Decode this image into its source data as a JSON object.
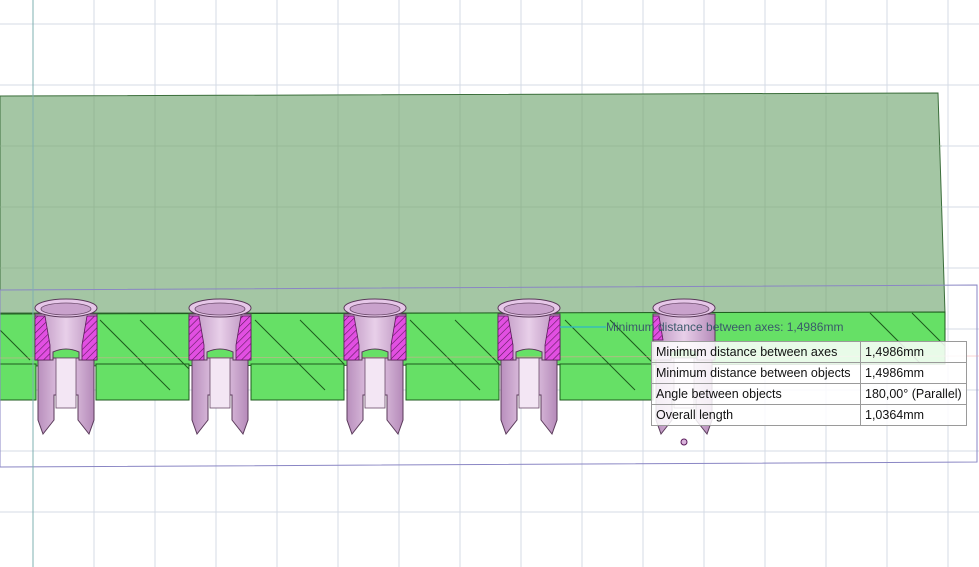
{
  "viewport": {
    "dimension_annotation": "Minimum distance between axes: 1,4986mm",
    "colors": {
      "background": "#ffffff",
      "grid": "#d4dbe6",
      "top_face": "#9fc39f",
      "front_face": "#66e066",
      "pin_body": "#d9b3dc",
      "section_hatch": "#e24fe2",
      "selection_box": "#8a86c4",
      "axis_line": "#7fb0b0"
    }
  },
  "measurement_table": {
    "rows": [
      {
        "label": "Minimum distance between axes",
        "value": "1,4986mm"
      },
      {
        "label": "Minimum distance between objects",
        "value": "1,4986mm"
      },
      {
        "label": "Angle between objects",
        "value": "180,00° (Parallel)"
      },
      {
        "label": "Overall length",
        "value": "1,0364mm"
      }
    ]
  }
}
